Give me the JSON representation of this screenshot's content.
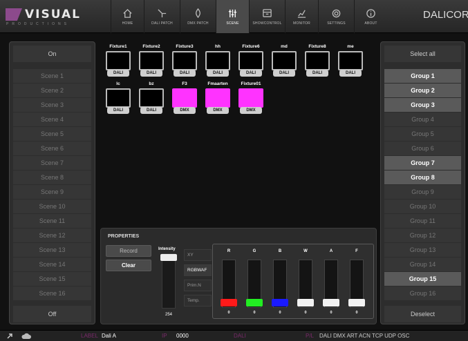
{
  "header": {
    "logo_text": "VISUAL",
    "logo_sub": "PRODUCTIONS",
    "brand": "DALICORE",
    "nav": [
      {
        "label": "HOME",
        "icon": "home-icon"
      },
      {
        "label": "DALI PATCH",
        "icon": "dali-patch-icon"
      },
      {
        "label": "DMX PATCH",
        "icon": "dmx-patch-icon"
      },
      {
        "label": "SCENE",
        "icon": "scene-sliders-icon",
        "active": true
      },
      {
        "label": "SHOWCONTROL",
        "icon": "showcontrol-icon"
      },
      {
        "label": "MONITOR",
        "icon": "monitor-icon"
      },
      {
        "label": "SETTINGS",
        "icon": "gear-icon"
      },
      {
        "label": "ABOUT",
        "icon": "info-icon"
      }
    ]
  },
  "scenes": {
    "on_label": "On",
    "off_label": "Off",
    "items": [
      "Scene 1",
      "Scene 2",
      "Scene 3",
      "Scene 4",
      "Scene 5",
      "Scene 6",
      "Scene 7",
      "Scene 8",
      "Scene 9",
      "Scene 10",
      "Scene 11",
      "Scene 12",
      "Scene 13",
      "Scene 14",
      "Scene 15",
      "Scene 16"
    ]
  },
  "groups": {
    "select_all_label": "Select all",
    "deselect_label": "Deselect",
    "items": [
      {
        "label": "Group 1",
        "selected": true
      },
      {
        "label": "Group 2",
        "selected": true
      },
      {
        "label": "Group 3",
        "selected": true
      },
      {
        "label": "Group 4",
        "selected": false
      },
      {
        "label": "Group 5",
        "selected": false
      },
      {
        "label": "Group 6",
        "selected": false
      },
      {
        "label": "Group 7",
        "selected": true
      },
      {
        "label": "Group 8",
        "selected": true
      },
      {
        "label": "Group 9",
        "selected": false
      },
      {
        "label": "Group 10",
        "selected": false
      },
      {
        "label": "Group 11",
        "selected": false
      },
      {
        "label": "Group 12",
        "selected": false
      },
      {
        "label": "Group 13",
        "selected": false
      },
      {
        "label": "Group 14",
        "selected": false
      },
      {
        "label": "Group 15",
        "selected": true
      },
      {
        "label": "Group 16",
        "selected": false
      }
    ]
  },
  "fixtures": [
    {
      "name": "Fixture1",
      "type": "DALI",
      "color": "#000000"
    },
    {
      "name": "Fixture2",
      "type": "DALI",
      "color": "#000000"
    },
    {
      "name": "Fixture3",
      "type": "DALI",
      "color": "#000000"
    },
    {
      "name": "hh",
      "type": "DALI",
      "color": "#000000"
    },
    {
      "name": "Fixture6",
      "type": "DALI",
      "color": "#000000"
    },
    {
      "name": "md",
      "type": "DALI",
      "color": "#000000"
    },
    {
      "name": "Fixture8",
      "type": "DALI",
      "color": "#000000"
    },
    {
      "name": "me",
      "type": "DALI",
      "color": "#000000"
    },
    {
      "name": "lc",
      "type": "DALI",
      "color": "#000000"
    },
    {
      "name": "bz",
      "type": "DALI",
      "color": "#000000"
    },
    {
      "name": "F3",
      "type": "DMX",
      "color": "#ff33ff"
    },
    {
      "name": "Fmaarten",
      "type": "DMX",
      "color": "#ff33ff"
    },
    {
      "name": "Fixture01",
      "type": "DMX",
      "color": "#ff33ff"
    }
  ],
  "properties": {
    "title": "PROPERTIES",
    "record_label": "Record",
    "clear_label": "Clear",
    "intensity_label": "Intensity",
    "intensity_value": "254",
    "intensity_level": 1.0,
    "modes": [
      {
        "label": "XY",
        "selected": false
      },
      {
        "label": "RGBWAF",
        "selected": true
      },
      {
        "label": "Prim.N",
        "selected": false
      },
      {
        "label": "Temp.",
        "selected": false
      }
    ],
    "channels": [
      {
        "label": "R",
        "value": "0",
        "level": 0,
        "color": "#ff1a1a"
      },
      {
        "label": "G",
        "value": "0",
        "level": 0,
        "color": "#22ee22"
      },
      {
        "label": "B",
        "value": "0",
        "level": 0,
        "color": "#1a1aff"
      },
      {
        "label": "W",
        "value": "0",
        "level": 0,
        "color": "#f2f2f2"
      },
      {
        "label": "A",
        "value": "0",
        "level": 0,
        "color": "#f2f2f2"
      },
      {
        "label": "F",
        "value": "0",
        "level": 0,
        "color": "#f2f2f2"
      }
    ]
  },
  "status": {
    "label_caption": "LABEL",
    "label_value": "Dali A",
    "ip_caption": "IP",
    "ip_value": "0000",
    "dali_caption": "DALI",
    "protocols_caption": "P/L",
    "protocols_value": "DALI DMX ART ACN TCP UDP OSC"
  }
}
